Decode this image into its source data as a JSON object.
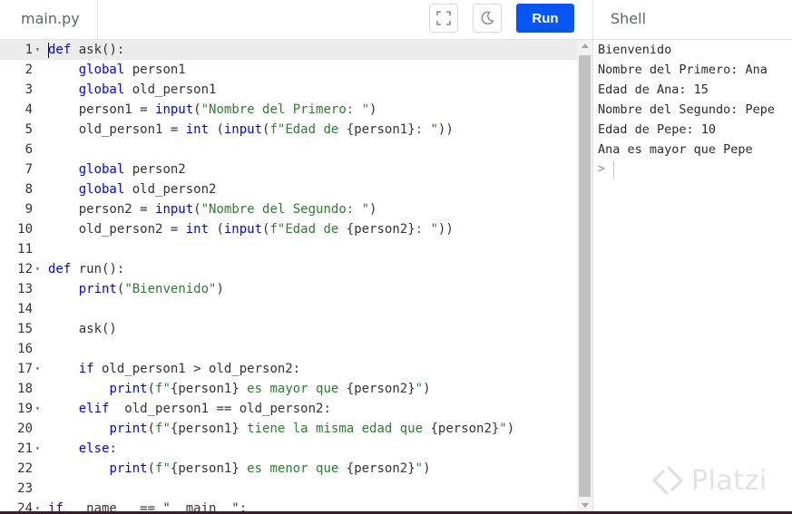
{
  "editor": {
    "file_tab": "main.py",
    "run_label": "Run",
    "lines": [
      {
        "num": "1",
        "fold": true,
        "tokens": [
          {
            "t": "def",
            "c": "kw"
          },
          {
            "t": " ask():",
            "c": ""
          }
        ]
      },
      {
        "num": "2",
        "fold": false,
        "tokens": [
          {
            "t": "    ",
            "c": ""
          },
          {
            "t": "global",
            "c": "kw"
          },
          {
            "t": " person1",
            "c": ""
          }
        ]
      },
      {
        "num": "3",
        "fold": false,
        "tokens": [
          {
            "t": "    ",
            "c": ""
          },
          {
            "t": "global",
            "c": "kw"
          },
          {
            "t": " old_person1",
            "c": ""
          }
        ]
      },
      {
        "num": "4",
        "fold": false,
        "tokens": [
          {
            "t": "    person1 = ",
            "c": ""
          },
          {
            "t": "input",
            "c": "kw"
          },
          {
            "t": "(",
            "c": ""
          },
          {
            "t": "\"Nombre del Primero: \"",
            "c": "str"
          },
          {
            "t": ")",
            "c": ""
          }
        ]
      },
      {
        "num": "5",
        "fold": false,
        "tokens": [
          {
            "t": "    old_person1 = ",
            "c": ""
          },
          {
            "t": "int",
            "c": "kw"
          },
          {
            "t": " (",
            "c": ""
          },
          {
            "t": "input",
            "c": "kw"
          },
          {
            "t": "(",
            "c": ""
          },
          {
            "t": "f\"Edad de ",
            "c": "str"
          },
          {
            "t": "{person1}",
            "c": ""
          },
          {
            "t": ": \"",
            "c": "str"
          },
          {
            "t": "))",
            "c": ""
          }
        ]
      },
      {
        "num": "6",
        "fold": false,
        "tokens": []
      },
      {
        "num": "7",
        "fold": false,
        "tokens": [
          {
            "t": "    ",
            "c": ""
          },
          {
            "t": "global",
            "c": "kw"
          },
          {
            "t": " person2",
            "c": ""
          }
        ]
      },
      {
        "num": "8",
        "fold": false,
        "tokens": [
          {
            "t": "    ",
            "c": ""
          },
          {
            "t": "global",
            "c": "kw"
          },
          {
            "t": " old_person2",
            "c": ""
          }
        ]
      },
      {
        "num": "9",
        "fold": false,
        "tokens": [
          {
            "t": "    person2 = ",
            "c": ""
          },
          {
            "t": "input",
            "c": "kw"
          },
          {
            "t": "(",
            "c": ""
          },
          {
            "t": "\"Nombre del Segundo: \"",
            "c": "str"
          },
          {
            "t": ")",
            "c": ""
          }
        ]
      },
      {
        "num": "10",
        "fold": false,
        "tokens": [
          {
            "t": "    old_person2 = ",
            "c": ""
          },
          {
            "t": "int",
            "c": "kw"
          },
          {
            "t": " (",
            "c": ""
          },
          {
            "t": "input",
            "c": "kw"
          },
          {
            "t": "(",
            "c": ""
          },
          {
            "t": "f\"Edad de ",
            "c": "str"
          },
          {
            "t": "{person2}",
            "c": ""
          },
          {
            "t": ": \"",
            "c": "str"
          },
          {
            "t": "))",
            "c": ""
          }
        ]
      },
      {
        "num": "11",
        "fold": false,
        "tokens": []
      },
      {
        "num": "12",
        "fold": true,
        "tokens": [
          {
            "t": "def",
            "c": "kw"
          },
          {
            "t": " run():",
            "c": ""
          }
        ]
      },
      {
        "num": "13",
        "fold": false,
        "tokens": [
          {
            "t": "    ",
            "c": ""
          },
          {
            "t": "print",
            "c": "kw"
          },
          {
            "t": "(",
            "c": ""
          },
          {
            "t": "\"Bienvenido\"",
            "c": "str"
          },
          {
            "t": ")",
            "c": ""
          }
        ]
      },
      {
        "num": "14",
        "fold": false,
        "tokens": []
      },
      {
        "num": "15",
        "fold": false,
        "tokens": [
          {
            "t": "    ask()",
            "c": ""
          }
        ]
      },
      {
        "num": "16",
        "fold": false,
        "tokens": []
      },
      {
        "num": "17",
        "fold": true,
        "tokens": [
          {
            "t": "    ",
            "c": ""
          },
          {
            "t": "if",
            "c": "kw"
          },
          {
            "t": " old_person1 > old_person2:",
            "c": ""
          }
        ]
      },
      {
        "num": "18",
        "fold": false,
        "tokens": [
          {
            "t": "        ",
            "c": ""
          },
          {
            "t": "print",
            "c": "kw"
          },
          {
            "t": "(",
            "c": ""
          },
          {
            "t": "f\"",
            "c": "str"
          },
          {
            "t": "{person1}",
            "c": ""
          },
          {
            "t": " es mayor que ",
            "c": "str"
          },
          {
            "t": "{person2}",
            "c": ""
          },
          {
            "t": "\"",
            "c": "str"
          },
          {
            "t": ")",
            "c": ""
          }
        ]
      },
      {
        "num": "19",
        "fold": true,
        "tokens": [
          {
            "t": "    ",
            "c": ""
          },
          {
            "t": "elif",
            "c": "kw"
          },
          {
            "t": "  old_person1 == old_person2:",
            "c": ""
          }
        ]
      },
      {
        "num": "20",
        "fold": false,
        "tokens": [
          {
            "t": "        ",
            "c": ""
          },
          {
            "t": "print",
            "c": "kw"
          },
          {
            "t": "(",
            "c": ""
          },
          {
            "t": "f\"",
            "c": "str"
          },
          {
            "t": "{person1}",
            "c": ""
          },
          {
            "t": " tiene la misma edad que ",
            "c": "str"
          },
          {
            "t": "{person2}",
            "c": ""
          },
          {
            "t": "\"",
            "c": "str"
          },
          {
            "t": ")",
            "c": ""
          }
        ]
      },
      {
        "num": "21",
        "fold": true,
        "tokens": [
          {
            "t": "    ",
            "c": ""
          },
          {
            "t": "else",
            "c": "kw"
          },
          {
            "t": ":",
            "c": ""
          }
        ]
      },
      {
        "num": "22",
        "fold": false,
        "tokens": [
          {
            "t": "        ",
            "c": ""
          },
          {
            "t": "print",
            "c": "kw"
          },
          {
            "t": "(",
            "c": ""
          },
          {
            "t": "f\"",
            "c": "str"
          },
          {
            "t": "{person1}",
            "c": ""
          },
          {
            "t": " es menor que ",
            "c": "str"
          },
          {
            "t": "{person2}",
            "c": ""
          },
          {
            "t": "\"",
            "c": "str"
          },
          {
            "t": ")",
            "c": ""
          }
        ]
      },
      {
        "num": "23",
        "fold": false,
        "tokens": []
      },
      {
        "num": "24",
        "fold": true,
        "tokens": [
          {
            "t": "if",
            "c": "kw"
          },
          {
            "t": " __name__ == \"__main__\":",
            "c": ""
          }
        ]
      }
    ]
  },
  "shell": {
    "tab_label": "Shell",
    "output_lines": [
      "Bienvenido",
      "Nombre del Primero: Ana",
      "Edad de Ana: 15",
      "Nombre del Segundo: Pepe",
      "Edad de Pepe: 10",
      "Ana es mayor que Pepe"
    ],
    "prompt": ">"
  },
  "watermark": {
    "text": "Platzi"
  },
  "icons": {
    "fullscreen": "fullscreen-icon",
    "theme": "moon-icon",
    "fold": "chevron-down-icon",
    "watermark_logo": "platzi-logo-icon"
  },
  "colors": {
    "run_button": "#0556f3",
    "keyword": "#0000ff",
    "string": "#2e7d32",
    "active_line": "#ececec"
  }
}
